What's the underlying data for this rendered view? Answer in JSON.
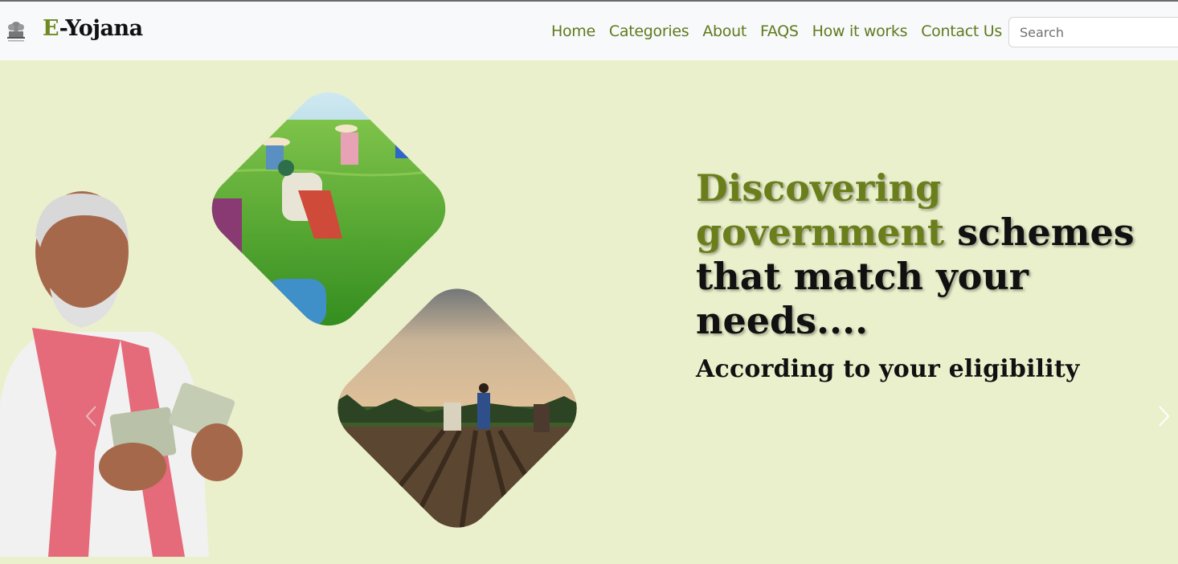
{
  "navbar": {
    "brand_first": "E",
    "brand_rest": "-Yojana",
    "emblem_icon": "national-emblem-icon",
    "links": [
      "Home",
      "Categories",
      "About",
      "FAQS",
      "How it works",
      "Contact Us"
    ],
    "search_placeholder": "Search",
    "link_color": "#5f7a1e"
  },
  "hero": {
    "headline_highlight": "Discovering government",
    "headline_rest": " schemes that match your needs....",
    "subline": "According to your eligibility",
    "highlight_color": "#6a7f1c",
    "background": "#ebf0cc",
    "next_icon": "chevron-right-icon",
    "prev_icon": "chevron-left-icon",
    "images": [
      "rice-field-workers-image",
      "farmer-ploughing-image",
      "smiling-farmer-with-money-image"
    ]
  }
}
